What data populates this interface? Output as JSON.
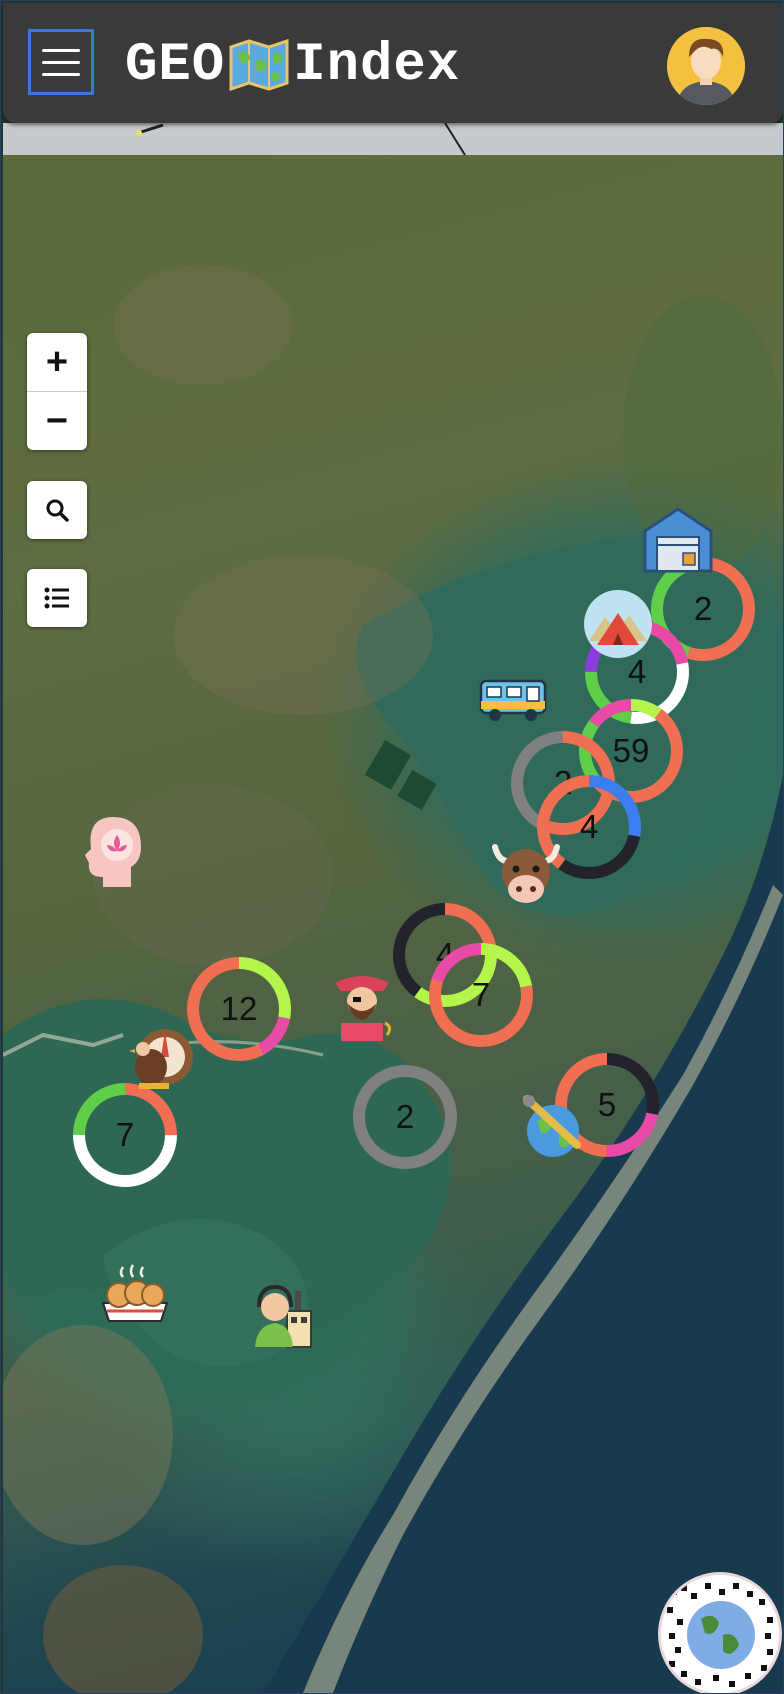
{
  "app": {
    "title_left": "GEO",
    "title_right": "Index",
    "logo_icon": "world-map-icon",
    "menu_icon": "hamburger-menu-icon",
    "avatar_icon": "user-avatar-icon"
  },
  "map_controls": {
    "zoom_in": "+",
    "zoom_out": "−",
    "search_icon": "search-icon",
    "list_icon": "list-icon"
  },
  "clusters": [
    {
      "id": "c1",
      "count": "2"
    },
    {
      "id": "c2",
      "count": "4"
    },
    {
      "id": "c3",
      "count": "59"
    },
    {
      "id": "c4",
      "count": "2"
    },
    {
      "id": "c5",
      "count": "4"
    },
    {
      "id": "c6",
      "count": "4"
    },
    {
      "id": "c7",
      "count": "7"
    },
    {
      "id": "c8",
      "count": "12"
    },
    {
      "id": "c9",
      "count": "2"
    },
    {
      "id": "c10",
      "count": "5"
    },
    {
      "id": "c11",
      "count": "7"
    }
  ],
  "markers": [
    "warehouse-icon",
    "camping-tent-icon",
    "camper-van-icon",
    "mindfulness-head-icon",
    "bull-head-icon",
    "pirate-icon",
    "turkey-icon",
    "globe-icon",
    "cookies-icon",
    "air-traffic-controller-icon"
  ],
  "colors": {
    "coral": "#f06e52",
    "green": "#5fcf4a",
    "lime": "#b3f54a",
    "purple": "#8a3cdc",
    "pink": "#e94aa8",
    "white": "#ffffff",
    "black": "#22232b",
    "blue": "#3c7ef0",
    "grey": "#808080"
  }
}
